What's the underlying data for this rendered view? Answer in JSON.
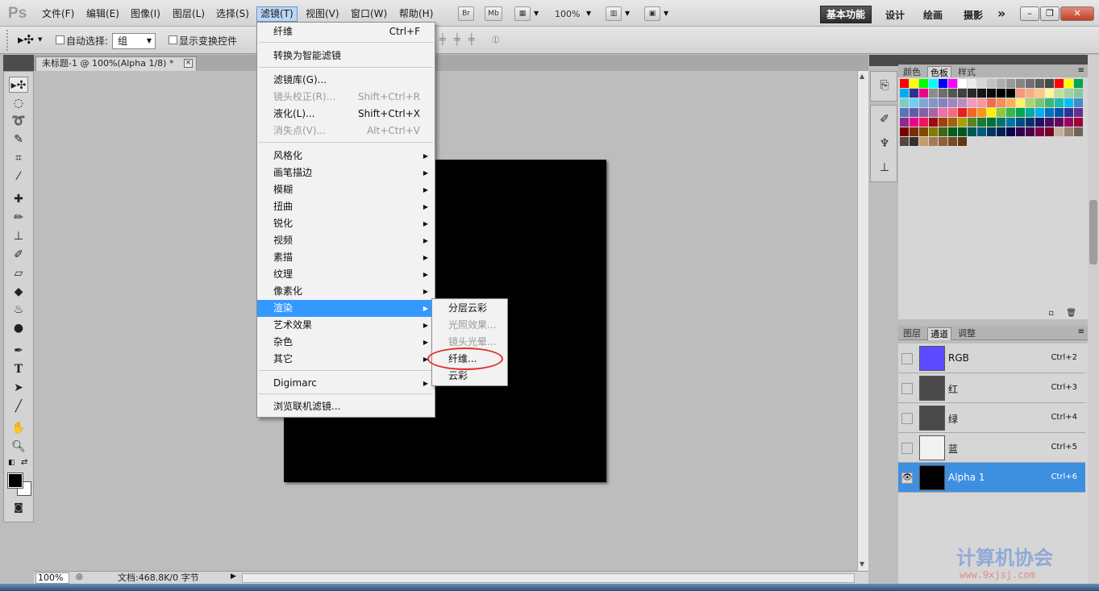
{
  "menubar": {
    "logo": "Ps",
    "items": [
      "文件(F)",
      "编辑(E)",
      "图像(I)",
      "图层(L)",
      "选择(S)",
      "滤镜(T)",
      "视图(V)",
      "窗口(W)",
      "帮助(H)"
    ],
    "br_label": "Br",
    "mb_label": "Mb",
    "zoom": "100%",
    "workspaces": [
      "基本功能",
      "设计",
      "绘画",
      "摄影"
    ],
    "more": "»"
  },
  "options": {
    "auto_select_label": "自动选择:",
    "auto_select_value": "组",
    "show_transform_label": "显示变换控件"
  },
  "doc_tab": {
    "title": "未标题-1 @ 100%(Alpha 1/8) *",
    "close": "×"
  },
  "filter_menu": {
    "items": [
      {
        "label": "纤维",
        "shortcut": "Ctrl+F",
        "disabled": false
      },
      {
        "label": "转换为智能滤镜",
        "shortcut": "",
        "disabled": false
      },
      {
        "label": "滤镜库(G)...",
        "shortcut": "",
        "disabled": false
      },
      {
        "label": "镜头校正(R)...",
        "shortcut": "Shift+Ctrl+R",
        "disabled": true
      },
      {
        "label": "液化(L)...",
        "shortcut": "Shift+Ctrl+X",
        "disabled": false
      },
      {
        "label": "消失点(V)...",
        "shortcut": "Alt+Ctrl+V",
        "disabled": true
      },
      {
        "label": "风格化",
        "submenu": true
      },
      {
        "label": "画笔描边",
        "submenu": true
      },
      {
        "label": "模糊",
        "submenu": true
      },
      {
        "label": "扭曲",
        "submenu": true
      },
      {
        "label": "锐化",
        "submenu": true
      },
      {
        "label": "视频",
        "submenu": true
      },
      {
        "label": "素描",
        "submenu": true
      },
      {
        "label": "纹理",
        "submenu": true
      },
      {
        "label": "像素化",
        "submenu": true
      },
      {
        "label": "渲染",
        "submenu": true,
        "highlighted": true
      },
      {
        "label": "艺术效果",
        "submenu": true
      },
      {
        "label": "杂色",
        "submenu": true
      },
      {
        "label": "其它",
        "submenu": true
      },
      {
        "label": "Digimarc",
        "submenu": true
      },
      {
        "label": "浏览联机滤镜...",
        "shortcut": ""
      }
    ]
  },
  "render_submenu": {
    "items": [
      {
        "label": "分层云彩",
        "disabled": false
      },
      {
        "label": "光照效果...",
        "disabled": true
      },
      {
        "label": "镜头光晕...",
        "disabled": true
      },
      {
        "label": "纤维...",
        "disabled": false
      },
      {
        "label": "云彩",
        "disabled": false
      }
    ]
  },
  "status": {
    "zoom": "100%",
    "doc_info": "文档:468.8K/0 字节"
  },
  "panels": {
    "top_tabs": [
      "颜色",
      "色板",
      "样式"
    ],
    "bottom_tabs": [
      "图层",
      "通道",
      "调整"
    ]
  },
  "channels": [
    {
      "name": "RGB",
      "shortcut": "Ctrl+2",
      "thumb_color": "#5b4bff",
      "visible": false,
      "selected": false
    },
    {
      "name": "红",
      "shortcut": "Ctrl+3",
      "thumb_color": "#4a4a4a",
      "visible": false,
      "selected": false
    },
    {
      "name": "绿",
      "shortcut": "Ctrl+4",
      "thumb_color": "#4a4a4a",
      "visible": false,
      "selected": false
    },
    {
      "name": "蓝",
      "shortcut": "Ctrl+5",
      "thumb_color": "#f2f2f2",
      "visible": false,
      "selected": false
    },
    {
      "name": "Alpha 1",
      "shortcut": "Ctrl+6",
      "thumb_color": "#000000",
      "visible": true,
      "selected": true
    }
  ],
  "swatches": [
    "#ff0000",
    "#ffff00",
    "#00ff00",
    "#00ffff",
    "#0000ff",
    "#ff00ff",
    "#ffffff",
    "#ebebeb",
    "#d6d6d6",
    "#c2c2c2",
    "#adadad",
    "#999999",
    "#858585",
    "#707070",
    "#5c5c5c",
    "#474747",
    "#ff0000",
    "#ffff00",
    "#00a651",
    "#00aeef",
    "#2e3192",
    "#ec008c",
    "#8c8c8c",
    "#6e6e6e",
    "#555555",
    "#404040",
    "#2a2a2a",
    "#151515",
    "#0a0a0a",
    "#000000",
    "#000000",
    "#f7977a",
    "#f9ad81",
    "#fdc68a",
    "#fff79a",
    "#c4df9b",
    "#a3d39c",
    "#82ca9d",
    "#7bcdc8",
    "#6ecff6",
    "#7ea7d8",
    "#8493ca",
    "#8882be",
    "#a187be",
    "#bc8dbf",
    "#f49ac2",
    "#f6989d",
    "#f26c4f",
    "#f68e55",
    "#fbaf5c",
    "#fff467",
    "#acd372",
    "#7cc576",
    "#3bb878",
    "#1abbb4",
    "#00bff3",
    "#438ccb",
    "#5574b9",
    "#605ca8",
    "#855fa8",
    "#a763a8",
    "#f06ea9",
    "#f26d7d",
    "#ed1c24",
    "#f26522",
    "#f7941d",
    "#fff200",
    "#8dc73f",
    "#39b54a",
    "#00a651",
    "#00a99d",
    "#00aeef",
    "#0072bc",
    "#0054a6",
    "#2e3192",
    "#662d91",
    "#92278f",
    "#ec008c",
    "#ed145b",
    "#9e0b0f",
    "#a0410d",
    "#a36209",
    "#aba000",
    "#598527",
    "#1a7b30",
    "#007236",
    "#00746b",
    "#0076a3",
    "#004b80",
    "#003471",
    "#1b1464",
    "#440e62",
    "#630460",
    "#9e005d",
    "#9e0039",
    "#790000",
    "#7b2e00",
    "#7d4900",
    "#827b00",
    "#406618",
    "#005e20",
    "#005826",
    "#005952",
    "#005b7f",
    "#003663",
    "#002157",
    "#0d004c",
    "#32004b",
    "#4b0049",
    "#7b0046",
    "#7a0026",
    "#c7b299",
    "#998675",
    "#736357",
    "#534741",
    "#37302d",
    "#c69c6d",
    "#a67c52",
    "#8c6239",
    "#754c24",
    "#603913"
  ]
}
